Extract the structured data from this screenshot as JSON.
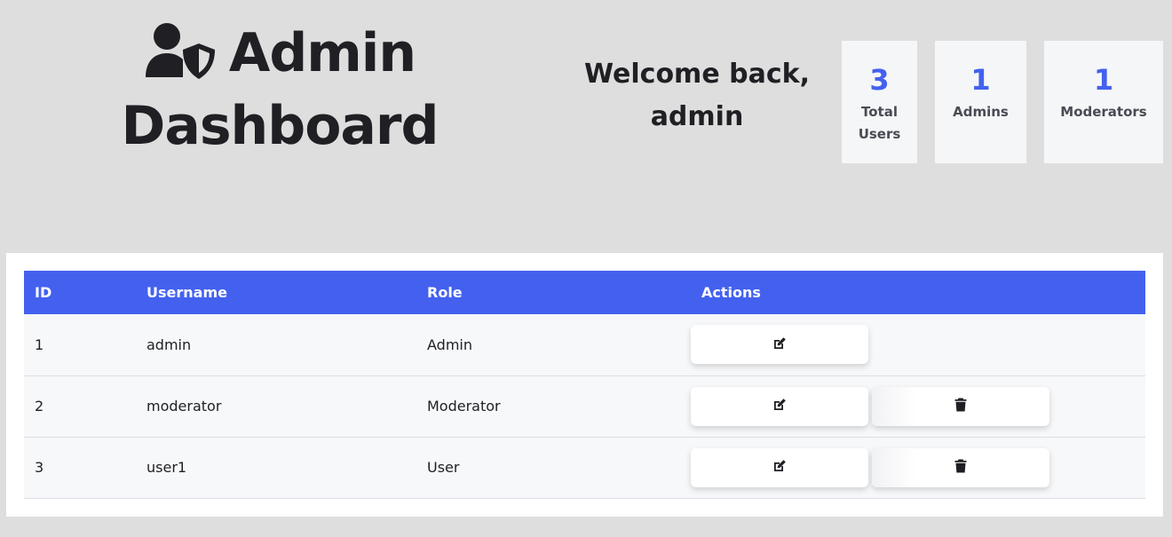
{
  "header": {
    "title_line1": "Admin",
    "title_line2": "Dashboard",
    "title_icon": "user-shield-icon",
    "welcome": "Welcome back, admin"
  },
  "stats": [
    {
      "value": "3",
      "label": "Total Users"
    },
    {
      "value": "1",
      "label": "Admins"
    },
    {
      "value": "1",
      "label": "Moderators"
    }
  ],
  "table": {
    "columns": [
      "ID",
      "Username",
      "Role",
      "Actions"
    ],
    "rows": [
      {
        "id": "1",
        "username": "admin",
        "role": "Admin",
        "actions": [
          "edit-icon"
        ]
      },
      {
        "id": "2",
        "username": "moderator",
        "role": "Moderator",
        "actions": [
          "edit-icon",
          "trash-icon"
        ]
      },
      {
        "id": "3",
        "username": "user1",
        "role": "User",
        "actions": [
          "edit-icon",
          "trash-icon"
        ]
      }
    ]
  },
  "colors": {
    "accent": "#4361ee",
    "background": "#dedede",
    "card": "#f5f6f8",
    "text": "#1f1f24"
  }
}
